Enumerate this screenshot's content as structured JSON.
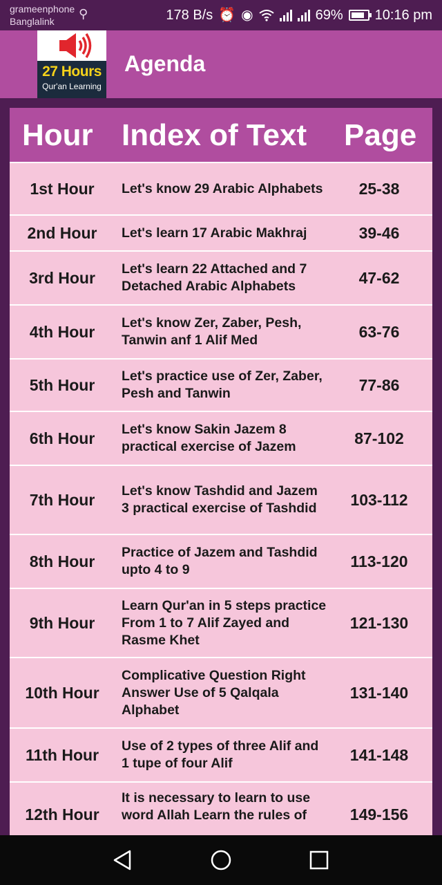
{
  "status_bar": {
    "carrier1": "grameenphone",
    "carrier2": "Banglalink",
    "net_speed": "178 B/s",
    "battery": "69%",
    "battery_level": 0.69,
    "time": "10:16 pm",
    "icons": [
      "usb-icon",
      "alarm-icon",
      "eye-icon",
      "wifi-icon",
      "signal-icon",
      "signal-icon",
      "battery-icon"
    ]
  },
  "app_bar": {
    "logo_hours": "27 Hours",
    "logo_subtitle": "Qur'an Learning",
    "title": "Agenda"
  },
  "table": {
    "headers": {
      "hour": "Hour",
      "index": "Index of Text",
      "page": "Page"
    },
    "rows": [
      {
        "hour": "1st Hour",
        "index": "Let's know 29 Arabic Alphabets",
        "page": "25-38"
      },
      {
        "hour": "2nd Hour",
        "index": "Let's learn 17 Arabic Makhraj",
        "page": "39-46"
      },
      {
        "hour": "3rd Hour",
        "index": "Let's learn 22 Attached and 7 Detached Arabic Alphabets",
        "page": "47-62"
      },
      {
        "hour": "4th Hour",
        "index": "Let's know Zer, Zaber, Pesh, Tanwin anf 1 Alif Med",
        "page": "63-76"
      },
      {
        "hour": "5th Hour",
        "index": "Let's practice use of Zer, Zaber, Pesh and Tanwin",
        "page": "77-86"
      },
      {
        "hour": "6th Hour",
        "index": "Let's know Sakin Jazem 8 practical exercise of Jazem",
        "page": "87-102"
      },
      {
        "hour": "7th Hour",
        "index": "Let's know Tashdid and Jazem 3 practical exercise of Tashdid",
        "page": "103-112"
      },
      {
        "hour": "8th Hour",
        "index": "Practice of Jazem and Tashdid upto 4 to 9",
        "page": "113-120"
      },
      {
        "hour": "9th Hour",
        "index": "Learn Qur'an in 5 steps practice From 1 to 7 Alif Zayed and Rasme Khet",
        "page": "121-130"
      },
      {
        "hour": "10th Hour",
        "index": "Complicative Question Right Answer Use of 5 Qalqala Alphabet",
        "page": "131-140"
      },
      {
        "hour": "11th Hour",
        "index": "Use of 2 types of three Alif and 1 tupe of four Alif",
        "page": "141-148"
      },
      {
        "hour": "12th Hour",
        "index": "It is necessary to learn to use word Allah Learn the rules of",
        "page": "149-156"
      }
    ]
  },
  "nav_bar": {
    "icons": [
      "back-icon",
      "home-icon",
      "recent-apps-icon"
    ]
  }
}
